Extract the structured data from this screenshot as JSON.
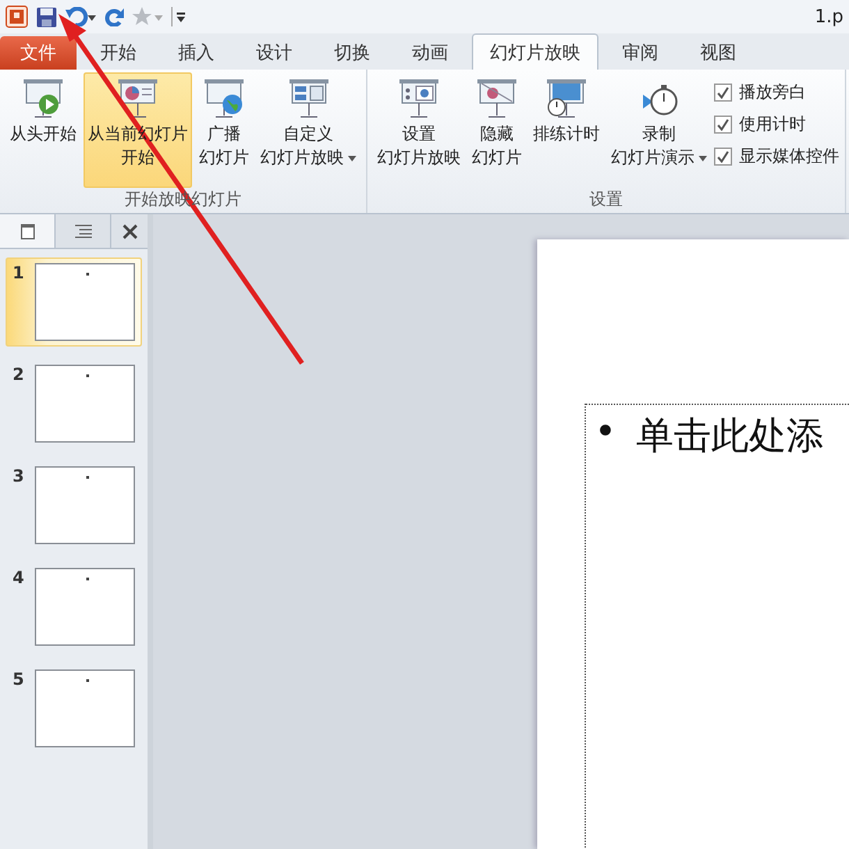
{
  "title_bar": {
    "title": "1.p"
  },
  "file_tab": {
    "label": "文件"
  },
  "tabs": [
    {
      "label": "开始",
      "selected": false
    },
    {
      "label": "插入",
      "selected": false
    },
    {
      "label": "设计",
      "selected": false
    },
    {
      "label": "切换",
      "selected": false
    },
    {
      "label": "动画",
      "selected": false
    },
    {
      "label": "幻灯片放映",
      "selected": true
    },
    {
      "label": "审阅",
      "selected": false
    },
    {
      "label": "视图",
      "selected": false
    }
  ],
  "ribbon_groups": [
    {
      "label": "开始放映幻灯片",
      "items": [
        {
          "kind": "button",
          "lines": [
            "从头开始"
          ],
          "highlighted": false,
          "dropdown": false
        },
        {
          "kind": "button",
          "lines": [
            "从当前幻灯片",
            "开始"
          ],
          "highlighted": true,
          "dropdown": false
        },
        {
          "kind": "button",
          "lines": [
            "广播",
            "幻灯片"
          ],
          "highlighted": false,
          "dropdown": false
        },
        {
          "kind": "button",
          "lines": [
            "自定义",
            "幻灯片放映"
          ],
          "highlighted": false,
          "dropdown": true
        }
      ]
    },
    {
      "label": "设置",
      "items": [
        {
          "kind": "button",
          "lines": [
            "设置",
            "幻灯片放映"
          ],
          "highlighted": false,
          "dropdown": false
        },
        {
          "kind": "button",
          "lines": [
            "隐藏",
            "幻灯片"
          ],
          "highlighted": false,
          "dropdown": false
        },
        {
          "kind": "button",
          "lines": [
            "排练计时"
          ],
          "highlighted": false,
          "dropdown": false
        },
        {
          "kind": "button",
          "lines": [
            "录制",
            "幻灯片演示"
          ],
          "highlighted": false,
          "dropdown": true
        },
        {
          "kind": "checks",
          "checks": [
            {
              "label": "播放旁白",
              "checked": true
            },
            {
              "label": "使用计时",
              "checked": true
            },
            {
              "label": "显示媒体控件",
              "checked": true
            }
          ]
        }
      ]
    }
  ],
  "slides": [
    {
      "number": "1",
      "selected": true
    },
    {
      "number": "2",
      "selected": false
    },
    {
      "number": "3",
      "selected": false
    },
    {
      "number": "4",
      "selected": false
    },
    {
      "number": "5",
      "selected": false
    }
  ],
  "slide": {
    "bullet": "•",
    "text": "单击此处添"
  }
}
